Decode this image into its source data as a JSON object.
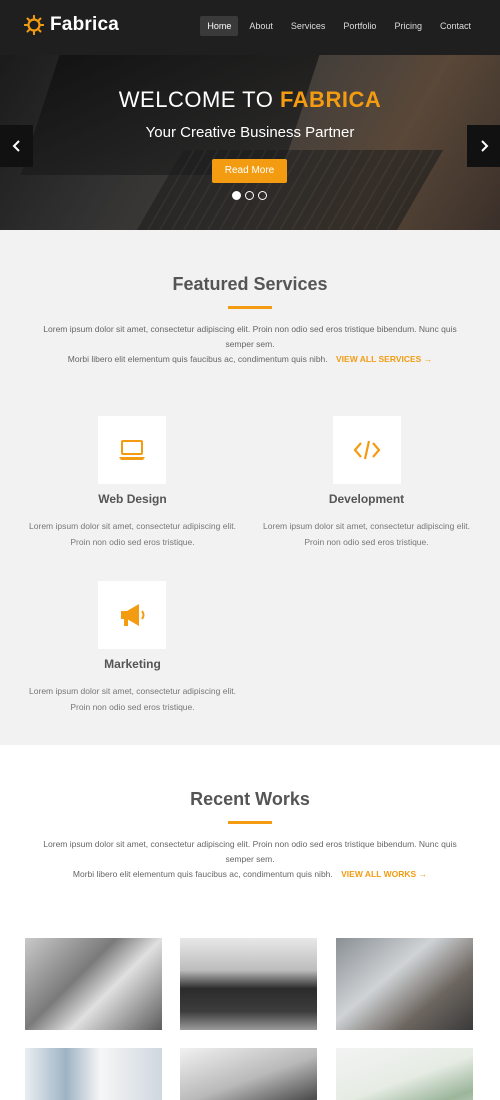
{
  "header": {
    "brand": "Fabrica",
    "nav": [
      "Home",
      "About",
      "Services",
      "Portfolio",
      "Pricing",
      "Contact"
    ],
    "active_nav": "Home"
  },
  "hero": {
    "title_prefix": "WELCOME TO",
    "title_accent": "FABRICA",
    "subtitle": "Your Creative Business Partner",
    "button": "Read More",
    "prev_icon": "chevron-left-icon",
    "next_icon": "chevron-right-icon",
    "slide_count": 3,
    "active_slide": 1
  },
  "services": {
    "title": "Featured Services",
    "intro_line1": "Lorem ipsum dolor sit amet, consectetur adipiscing elit. Proin non odio sed eros tristique bibendum. Nunc quis semper sem.",
    "intro_line2": "Morbi libero elit elementum quis faucibus ac, condimentum quis nibh.",
    "link": "VIEW ALL SERVICES →",
    "items": [
      {
        "title": "Web Design",
        "icon": "laptop-icon",
        "text1": "Lorem ipsum dolor sit amet, consectetur adipiscing elit.",
        "text2": "Proin non odio sed eros tristique."
      },
      {
        "title": "Development",
        "icon": "code-icon",
        "text1": "Lorem ipsum dolor sit amet, consectetur adipiscing elit.",
        "text2": "Proin non odio sed eros tristique."
      },
      {
        "title": "Marketing",
        "icon": "megaphone-icon",
        "text1": "Lorem ipsum dolor sit amet, consectetur adipiscing elit.",
        "text2": "Proin non odio sed eros tristique."
      }
    ]
  },
  "works": {
    "title": "Recent Works",
    "intro_line1": "Lorem ipsum dolor sit amet, consectetur adipiscing elit. Proin non odio sed eros tristique bibendum. Nunc quis semper sem.",
    "intro_line2": "Morbi libero elit elementum quis faucibus ac, condimentum quis nibh.",
    "link": "VIEW ALL WORKS →"
  },
  "colors": {
    "accent": "#f39c12",
    "header_bg": "#1f1f1f",
    "services_bg": "#f2f2f2"
  }
}
